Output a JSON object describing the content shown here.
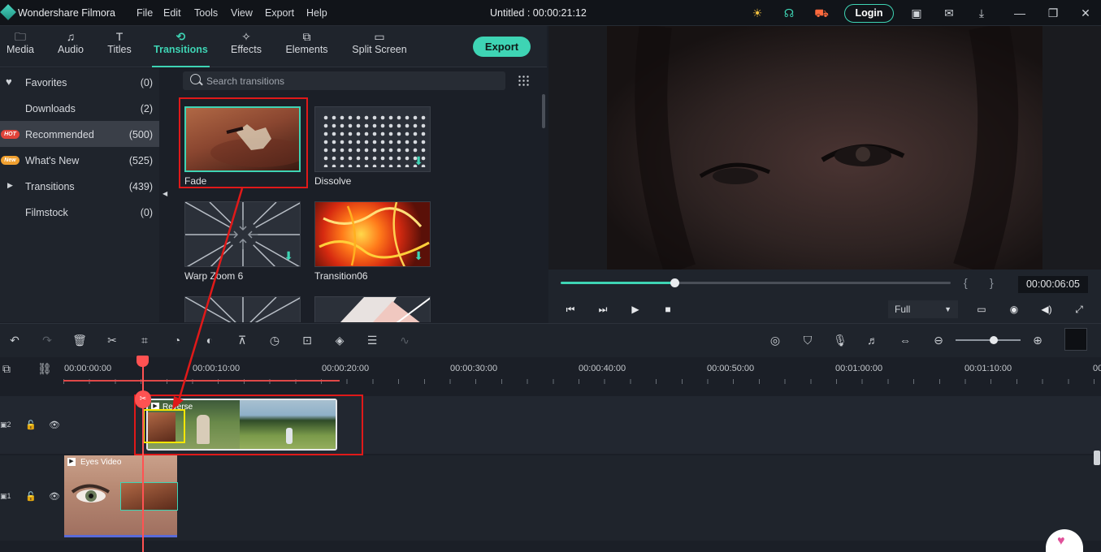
{
  "app": {
    "name": "Wondershare Filmora",
    "title": "Untitled : 00:00:21:12",
    "login_label": "Login"
  },
  "menu": [
    "File",
    "Edit",
    "Tools",
    "View",
    "Export",
    "Help"
  ],
  "tabs": [
    {
      "label": "Media",
      "icon": "folder-icon"
    },
    {
      "label": "Audio",
      "icon": "music-note-icon"
    },
    {
      "label": "Titles",
      "icon": "text-icon"
    },
    {
      "label": "Transitions",
      "icon": "transitions-icon",
      "active": true
    },
    {
      "label": "Effects",
      "icon": "effects-icon"
    },
    {
      "label": "Elements",
      "icon": "elements-icon"
    },
    {
      "label": "Split Screen",
      "icon": "split-screen-icon"
    }
  ],
  "export_label": "Export",
  "sidebar": {
    "items": [
      {
        "label": "Favorites",
        "count": "(0)",
        "icon": "heart-icon"
      },
      {
        "label": "Downloads",
        "count": "(2)"
      },
      {
        "label": "Recommended",
        "count": "(500)",
        "badge": "HOT",
        "selected": true
      },
      {
        "label": "What's New",
        "count": "(525)",
        "badge": "New"
      },
      {
        "label": "Transitions",
        "count": "(439)",
        "icon": "caret-right-icon"
      },
      {
        "label": "Filmstock",
        "count": "(0)"
      }
    ]
  },
  "search": {
    "placeholder": "Search transitions"
  },
  "transitions": [
    {
      "label": "Fade",
      "selected": true
    },
    {
      "label": "Dissolve",
      "download": true
    },
    {
      "label": "Warp Zoom 6",
      "download": true
    },
    {
      "label": "Transition06",
      "download": true
    }
  ],
  "player": {
    "timecode": "00:00:06:05",
    "quality": "Full",
    "progress": 0.29
  },
  "ruler": {
    "labels": [
      "00:00:00:00",
      "00:00:10:00",
      "00:00:20:00",
      "00:00:30:00",
      "00:00:40:00",
      "00:00:50:00",
      "00:01:00:00",
      "00:01:10:00",
      "00"
    ]
  },
  "tracks": {
    "track2_label": "2",
    "track1_label": "1",
    "clip_reverse": "Reverse",
    "clip_eyes": "Eyes Video"
  },
  "colors": {
    "accent": "#3ed4b4",
    "highlight_red": "#e01919",
    "highlight_yellow": "#f5e600",
    "playhead": "#ff5252"
  }
}
